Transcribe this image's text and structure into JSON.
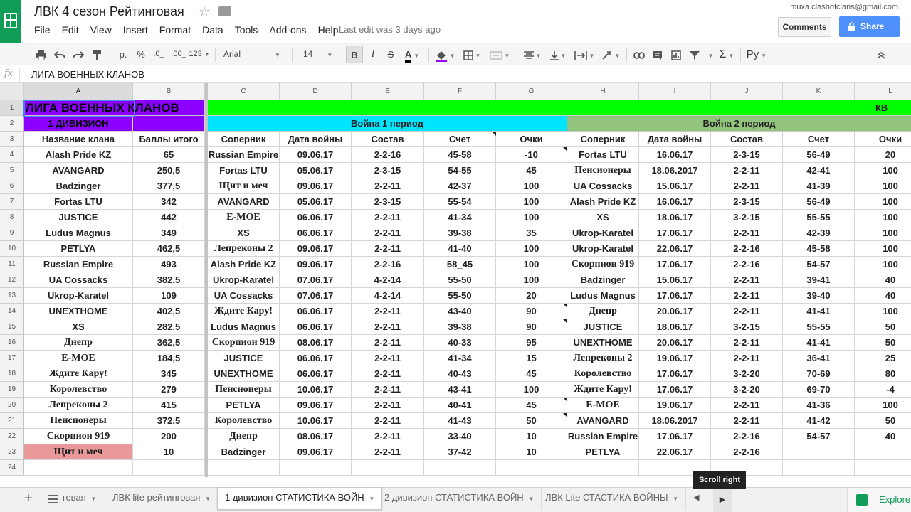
{
  "header": {
    "doc_title": "ЛВК 4 сезон Рейтинговая",
    "user_email": "muxa.clashofclans@gmail.com",
    "last_edit": "Last edit was 3 days ago",
    "comments_label": "Comments",
    "share_label": "Share",
    "menu": [
      "File",
      "Edit",
      "View",
      "Insert",
      "Format",
      "Data",
      "Tools",
      "Add-ons",
      "Help"
    ]
  },
  "toolbar": {
    "format_currency": "р.",
    "format_percent": "%",
    "decimal_decrease": ".0_",
    "decimal_increase": ".00_",
    "more_formats": "123",
    "font": "Arial",
    "font_size": "14",
    "bold": "B",
    "italic": "I",
    "input_tools": "Ру"
  },
  "formula_bar": {
    "fx": "fx",
    "value": "ЛИГА ВОЕННЫХ КЛАНОВ"
  },
  "columns": [
    "A",
    "B",
    "C",
    "D",
    "E",
    "F",
    "G",
    "H",
    "I",
    "J",
    "K",
    "L"
  ],
  "rows": [
    "1",
    "2",
    "3",
    "4",
    "5",
    "6",
    "7",
    "8",
    "9",
    "10",
    "11",
    "12",
    "13",
    "14",
    "15",
    "16",
    "17",
    "18",
    "19",
    "20",
    "21",
    "22",
    "23",
    "24"
  ],
  "sheet": {
    "title": "ЛИГА ВОЕННЫХ КЛАНОВ",
    "division": "1 ДИВИЗИОН",
    "kv_label": "КВ",
    "war1_label": "Война 1 период",
    "war2_label": "Война 2 период",
    "headers": [
      "Название клана",
      "Баллы итого",
      "Соперник",
      "Дата войны",
      "Состав",
      "Счет",
      "Очки",
      "Соперник",
      "Дата войны",
      "Состав",
      "Счет",
      "Очки"
    ],
    "table": [
      [
        "Alash Pride KZ",
        "65",
        "Russian Empire",
        "09.06.17",
        "2-2-16",
        "45-58",
        "-10",
        "Fortas LTU",
        "16.06.17",
        "2-3-15",
        "56-49",
        "20"
      ],
      [
        "AVANGARD",
        "250,5",
        "Fortas LTU",
        "05.06.17",
        "2-3-15",
        "54-55",
        "45",
        "Пенсионеры",
        "18.06.2017",
        "2-2-11",
        "42-41",
        "100"
      ],
      [
        "Badzinger",
        "377,5",
        "Щит и меч",
        "09.06.17",
        "2-2-11",
        "42-37",
        "100",
        "UA Cossacks",
        "15.06.17",
        "2-2-11",
        "41-39",
        "100"
      ],
      [
        "Fortas LTU",
        "342",
        "AVANGARD",
        "05.06.17",
        "2-3-15",
        "55-54",
        "100",
        "Alash Pride KZ",
        "16.06.17",
        "2-3-15",
        "56-49",
        "100"
      ],
      [
        "JUSTICE",
        "442",
        "E-MOE",
        "06.06.17",
        "2-2-11",
        "41-34",
        "100",
        "XS",
        "18.06.17",
        "3-2-15",
        "55-55",
        "100"
      ],
      [
        "Ludus Magnus",
        "349",
        "XS",
        "06.06.17",
        "2-2-11",
        "39-38",
        "35",
        "Ukrop-Karatel",
        "17.06.17",
        "2-2-11",
        "42-39",
        "100"
      ],
      [
        "PETLYA",
        "462,5",
        "Лепреконы 2",
        "09.06.17",
        "2-2-11",
        "41-40",
        "100",
        "Ukrop-Karatel",
        "22.06.17",
        "2-2-16",
        "45-58",
        "100"
      ],
      [
        "Russian Empire",
        "493",
        "Alash Pride KZ",
        "09.06.17",
        "2-2-16",
        "58_45",
        "100",
        "Скорпион 919",
        "17.06.17",
        "2-2-16",
        "54-57",
        "100"
      ],
      [
        "UA Cossacks",
        "382,5",
        "Ukrop-Karatel",
        "07.06.17",
        "4-2-14",
        "55-50",
        "100",
        "Badzinger",
        "15.06.17",
        "2-2-11",
        "39-41",
        "40"
      ],
      [
        "Ukrop-Karatel",
        "109",
        "UA Cossacks",
        "07.06.17",
        "4-2-14",
        "55-50",
        "20",
        "Ludus Magnus",
        "17.06.17",
        "2-2-11",
        "39-40",
        "40"
      ],
      [
        "UNEXTHOME",
        "402,5",
        "Ждите Кару!",
        "06.06.17",
        "2-2-11",
        "43-40",
        "90",
        "Днепр",
        "20.06.17",
        "2-2-11",
        "41-41",
        "100"
      ],
      [
        "XS",
        "282,5",
        "Ludus Magnus",
        "06.06.17",
        "2-2-11",
        "39-38",
        "90",
        "JUSTICE",
        "18.06.17",
        "3-2-15",
        "55-55",
        "50"
      ],
      [
        "Днепр",
        "362,5",
        "Скорпион 919",
        "08.06.17",
        "2-2-11",
        "40-33",
        "95",
        "UNEXTHOME",
        "20.06.17",
        "2-2-11",
        "41-41",
        "50"
      ],
      [
        "E-MOE",
        "184,5",
        "JUSTICE",
        "06.06.17",
        "2-2-11",
        "41-34",
        "15",
        "Лепреконы 2",
        "19.06.17",
        "2-2-11",
        "36-41",
        "25"
      ],
      [
        "Ждите Кару!",
        "345",
        "UNEXTHOME",
        "06.06.17",
        "2-2-11",
        "40-43",
        "45",
        "Королевство",
        "17.06.17",
        "3-2-20",
        "70-69",
        "80"
      ],
      [
        "Королевство",
        "279",
        "Пенсионеры",
        "10.06.17",
        "2-2-11",
        "43-41",
        "100",
        "Ждите Кару!",
        "17.06.17",
        "3-2-20",
        "69-70",
        "-4"
      ],
      [
        "Лепреконы 2",
        "415",
        "PETLYA",
        "09.06.17",
        "2-2-11",
        "40-41",
        "45",
        "E-MOE",
        "19.06.17",
        "2-2-11",
        "41-36",
        "100"
      ],
      [
        "Пенсионеры",
        "372,5",
        "Королевство",
        "10.06.17",
        "2-2-11",
        "41-43",
        "50",
        "AVANGARD",
        "18.06.2017",
        "2-2-11",
        "41-42",
        "50"
      ],
      [
        "Скорпион 919",
        "200",
        "Днепр",
        "08.06.17",
        "2-2-11",
        "33-40",
        "10",
        "Russian Empire",
        "17.06.17",
        "2-2-16",
        "54-57",
        "40"
      ],
      [
        "Щит и меч",
        "10",
        "Badzinger",
        "09.06.17",
        "2-2-11",
        "37-42",
        "10",
        "PETLYA",
        "22.06.17",
        "2-2-16",
        "",
        ""
      ]
    ]
  },
  "tabs": {
    "partial": "говая",
    "items": [
      "ЛВК lite рейтинговая",
      "1 дивизион СТАТИСТИКА ВОЙН",
      "2 дивизион СТАТИСТИКА ВОЙН",
      "ЛВК Lite СТАСТИКА ВОЙНЫ"
    ],
    "active_index": 1,
    "explore_label": "Explore",
    "tooltip": "Scroll right"
  },
  "colors": {
    "title_purple": "#8b00ff",
    "kv_green": "#00ff00",
    "war1_cyan": "#00e5ff",
    "war2_green": "#93c47d",
    "last_row_pink": "#ea9999",
    "share_blue": "#4d90fe",
    "sheets_green": "#0f9d58"
  }
}
